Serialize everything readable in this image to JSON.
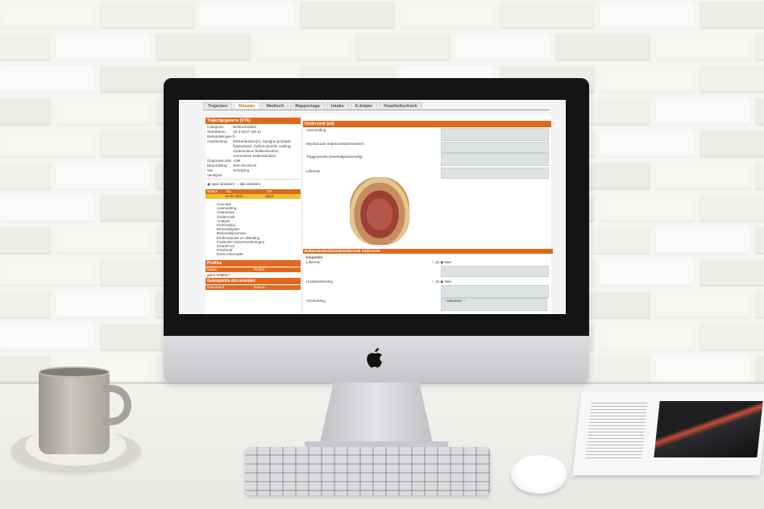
{
  "app": {
    "tabs": [
      "Trajecten",
      "Dossier",
      "Medisch",
      "Rapportage",
      "Intake",
      "E-Intake",
      "Kwaliteitscheck"
    ],
    "active_tab": "Dossier",
    "accent_color": "#e0691e"
  },
  "left_panel": {
    "header": "Trajectgegevens (VTA)",
    "fields": [
      {
        "k": "Categorie:",
        "v": "Bekkenbodem"
      },
      {
        "k": "Startdatum:",
        "v": "16-2-2017 (wk 5)"
      },
      {
        "k": "Behandelingen:",
        "v": "0"
      },
      {
        "k": "Aandoening:",
        "v": "bekkenbodem(n), benigne prostaat hyperplasie, dysfunctionele voiding, onderactieve bekkenbodem, overactieve bekkenbodem"
      },
      {
        "k": "Diagnosecode:",
        "v": "-195"
      },
      {
        "k": "Beoordeling:",
        "v": "Niet-chronisch"
      },
      {
        "k": "Via:",
        "v": "verwijzing"
      },
      {
        "k": "Verwijzer:",
        "v": ""
      }
    ],
    "radio_open": "open dossiers",
    "radio_all": "alle dossiers",
    "table_headers": [
      "Status",
      "Nu",
      "Ok"
    ],
    "table_row": [
      "",
      "16-02-2017",
      "open"
    ],
    "steps": [
      "Concept",
      "Aanmelding",
      "Anamnese",
      "Onderzoek",
      "Analyse",
      "Kinematica",
      "Behandelplan",
      "Behandeljournaal",
      "Eindevaluatie en afsluiting",
      "Fusionele trainersoefeningen",
      "SmartFocs",
      "Privébrief",
      "Extra informatie"
    ],
    "section2_header": "Profiles",
    "section2_cols": [
      "Naam",
      "Profiel"
    ],
    "section2_empty": "geen relaties /",
    "section3_header": "Gekoppelde documenten",
    "section3_cols": [
      "Document",
      "Datum"
    ]
  },
  "right_panel": {
    "section1_header": "Onderzoek (vd)",
    "labels": [
      "Aanmelding",
      "Myofasciale onderzoekstechnieken",
      "Triggerpoints (inwendig/uitwendig)",
      "Liftereiw"
    ],
    "section2_header": "Bekkenbodemfunctieonderzoek onderzoek",
    "inspectie_title": "Inspectie",
    "rows": [
      {
        "label": "Liftereiw",
        "ja": "Ja",
        "nee": "Nee"
      },
      {
        "label": "Huidaanstoeiing",
        "ja": "Ja",
        "nee": "Nee"
      },
      {
        "label": "Afschelding",
        "select": "-- selecteer --"
      }
    ]
  }
}
